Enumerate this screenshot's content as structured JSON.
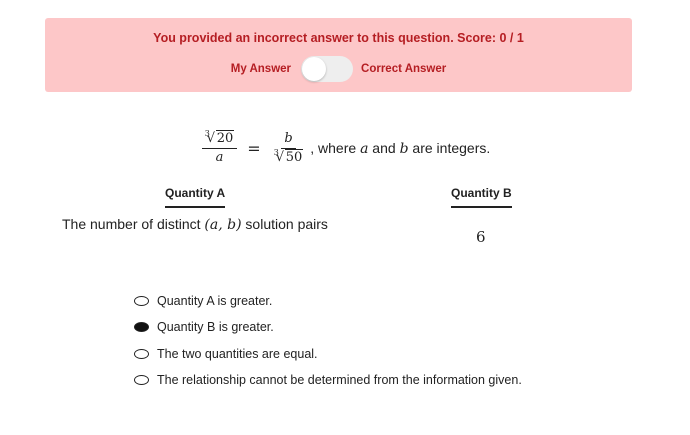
{
  "banner": {
    "message": "You provided an incorrect answer to this question. Score: 0 / 1",
    "my_answer_label": "My Answer",
    "correct_answer_label": "Correct Answer",
    "toggle_state": "My Answer"
  },
  "question": {
    "lhs_root_index": "3",
    "lhs_radicand": "20",
    "lhs_denominator": "a",
    "rhs_numerator": "b",
    "rhs_root_index": "3",
    "rhs_radicand": "50",
    "equals": "=",
    "where_text": ", where ",
    "var_a": "a",
    "and_text": " and ",
    "var_b": "b",
    "are_integers": " are integers."
  },
  "quantity_a": {
    "heading": "Quantity A",
    "text_before": "The number of distinct ",
    "math": "(a, b)",
    "text_after": " solution pairs"
  },
  "quantity_b": {
    "heading": "Quantity B",
    "value": "6"
  },
  "options": [
    {
      "label": "Quantity A is greater.",
      "selected": false
    },
    {
      "label": "Quantity B is greater.",
      "selected": true
    },
    {
      "label": "The two quantities are equal.",
      "selected": false
    },
    {
      "label": "The relationship cannot be determined from the information given.",
      "selected": false
    }
  ],
  "colors": {
    "banner_bg": "#fdc7c8",
    "banner_text": "#b51e23"
  }
}
